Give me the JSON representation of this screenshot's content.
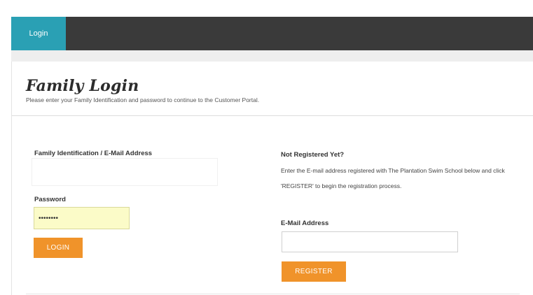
{
  "nav": {
    "tabs": [
      {
        "label": "Login"
      }
    ]
  },
  "header": {
    "title": "Family Login",
    "subtitle": "Please enter your Family Identification and password to continue to the Customer Portal."
  },
  "login": {
    "id_label": "Family Identification / E-Mail Address",
    "id_value": "",
    "password_label": "Password",
    "password_value": "••••••••",
    "button_label": "LOGIN"
  },
  "register": {
    "heading": "Not Registered Yet?",
    "info": "Enter the E-mail address registered with The Plantation Swim School below and click 'REGISTER' to begin the registration process.",
    "email_label": "E-Mail Address",
    "email_value": "",
    "button_label": "REGISTER"
  },
  "colors": {
    "tab_active": "#2aa0b4",
    "nav_bar": "#3a3a3a",
    "button": "#f0932a",
    "password_fill": "#fbfbc8"
  }
}
